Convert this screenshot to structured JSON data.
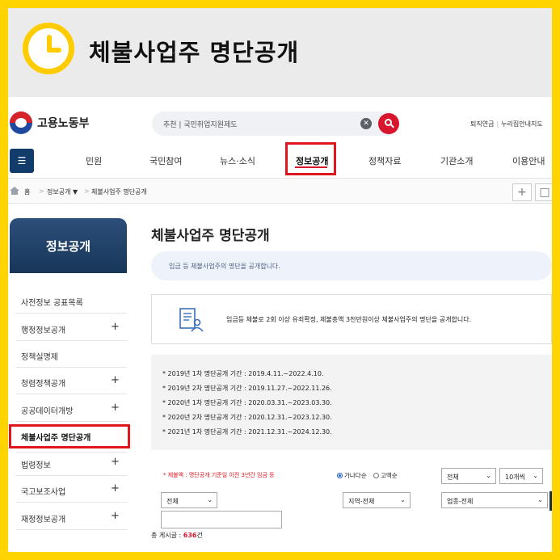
{
  "banner": {
    "title": "체불사업주 명단공개"
  },
  "header": {
    "logo_text": "고용노동부",
    "search_placeholder": "추천 | 국민취업지원제도",
    "utility_links": [
      "퇴직연금",
      "누리집안내지도"
    ]
  },
  "gnb": {
    "menu_label": "☰",
    "items": [
      "민원",
      "국민참여",
      "뉴스·소식",
      "정보공개",
      "정책자료",
      "기관소개",
      "이용안내"
    ],
    "active": "정보공개"
  },
  "breadcrumb": [
    "홈",
    "정보공개 ▼",
    "체불사업주 명단공개"
  ],
  "sidebar": {
    "title": "정보공개",
    "items": [
      {
        "label": "사전정보 공표목록",
        "expandable": false
      },
      {
        "label": "행정정보공개",
        "expandable": true
      },
      {
        "label": "정책실명제",
        "expandable": false
      },
      {
        "label": "청렴정책공개",
        "expandable": true
      },
      {
        "label": "공공데이터개방",
        "expandable": true
      },
      {
        "label": "체불사업주 명단공개",
        "expandable": false
      },
      {
        "label": "법령정보",
        "expandable": true
      },
      {
        "label": "국고보조사업",
        "expandable": true
      },
      {
        "label": "재정정보공개",
        "expandable": true
      }
    ],
    "active": "체불사업주 명단공개"
  },
  "content": {
    "title": "체불사업주 명단공개",
    "intro": "임금 등 체불사업주의 명단을 공개합니다.",
    "notice": "임금등 체불로 2회 이상 유죄확정, 체불총액 3천만원이상 체불사업주의 명단을 공개합니다.",
    "periods": [
      "* 2019년 1차 명단공개 기간 : 2019.4.11.~2022.4.10.",
      "* 2019년 2차 명단공개 기간 : 2019.11.27.~2022.11.26.",
      "* 2020년 1차 명단공개 기간 : 2020.03.31.~2023.03.30.",
      "* 2020년 2차 명단공개 기간 : 2020.12.31.~2023.12.30.",
      "* 2021년 1차 명단공개 기간 : 2021.12.31.~2024.12.30."
    ]
  },
  "filters": {
    "warning": "* 체불액 : 명단공개 기준일 이전 3년간 임금 등",
    "sort_options": [
      "가나다순",
      "고액순"
    ],
    "sort_selected": "가나다순",
    "select_all": "전체",
    "page_size": "10개씩",
    "select_type": "전체",
    "select_region": "지역-전체",
    "select_industry": "업종-전체",
    "search_value": ""
  },
  "total": {
    "label": "총 게시글 :",
    "count": "636",
    "unit": "건"
  },
  "colors": {
    "accent_red": "#d7152c",
    "navy": "#123d6a",
    "highlight": "#e0161f",
    "frame_yellow": "#ffd400"
  }
}
